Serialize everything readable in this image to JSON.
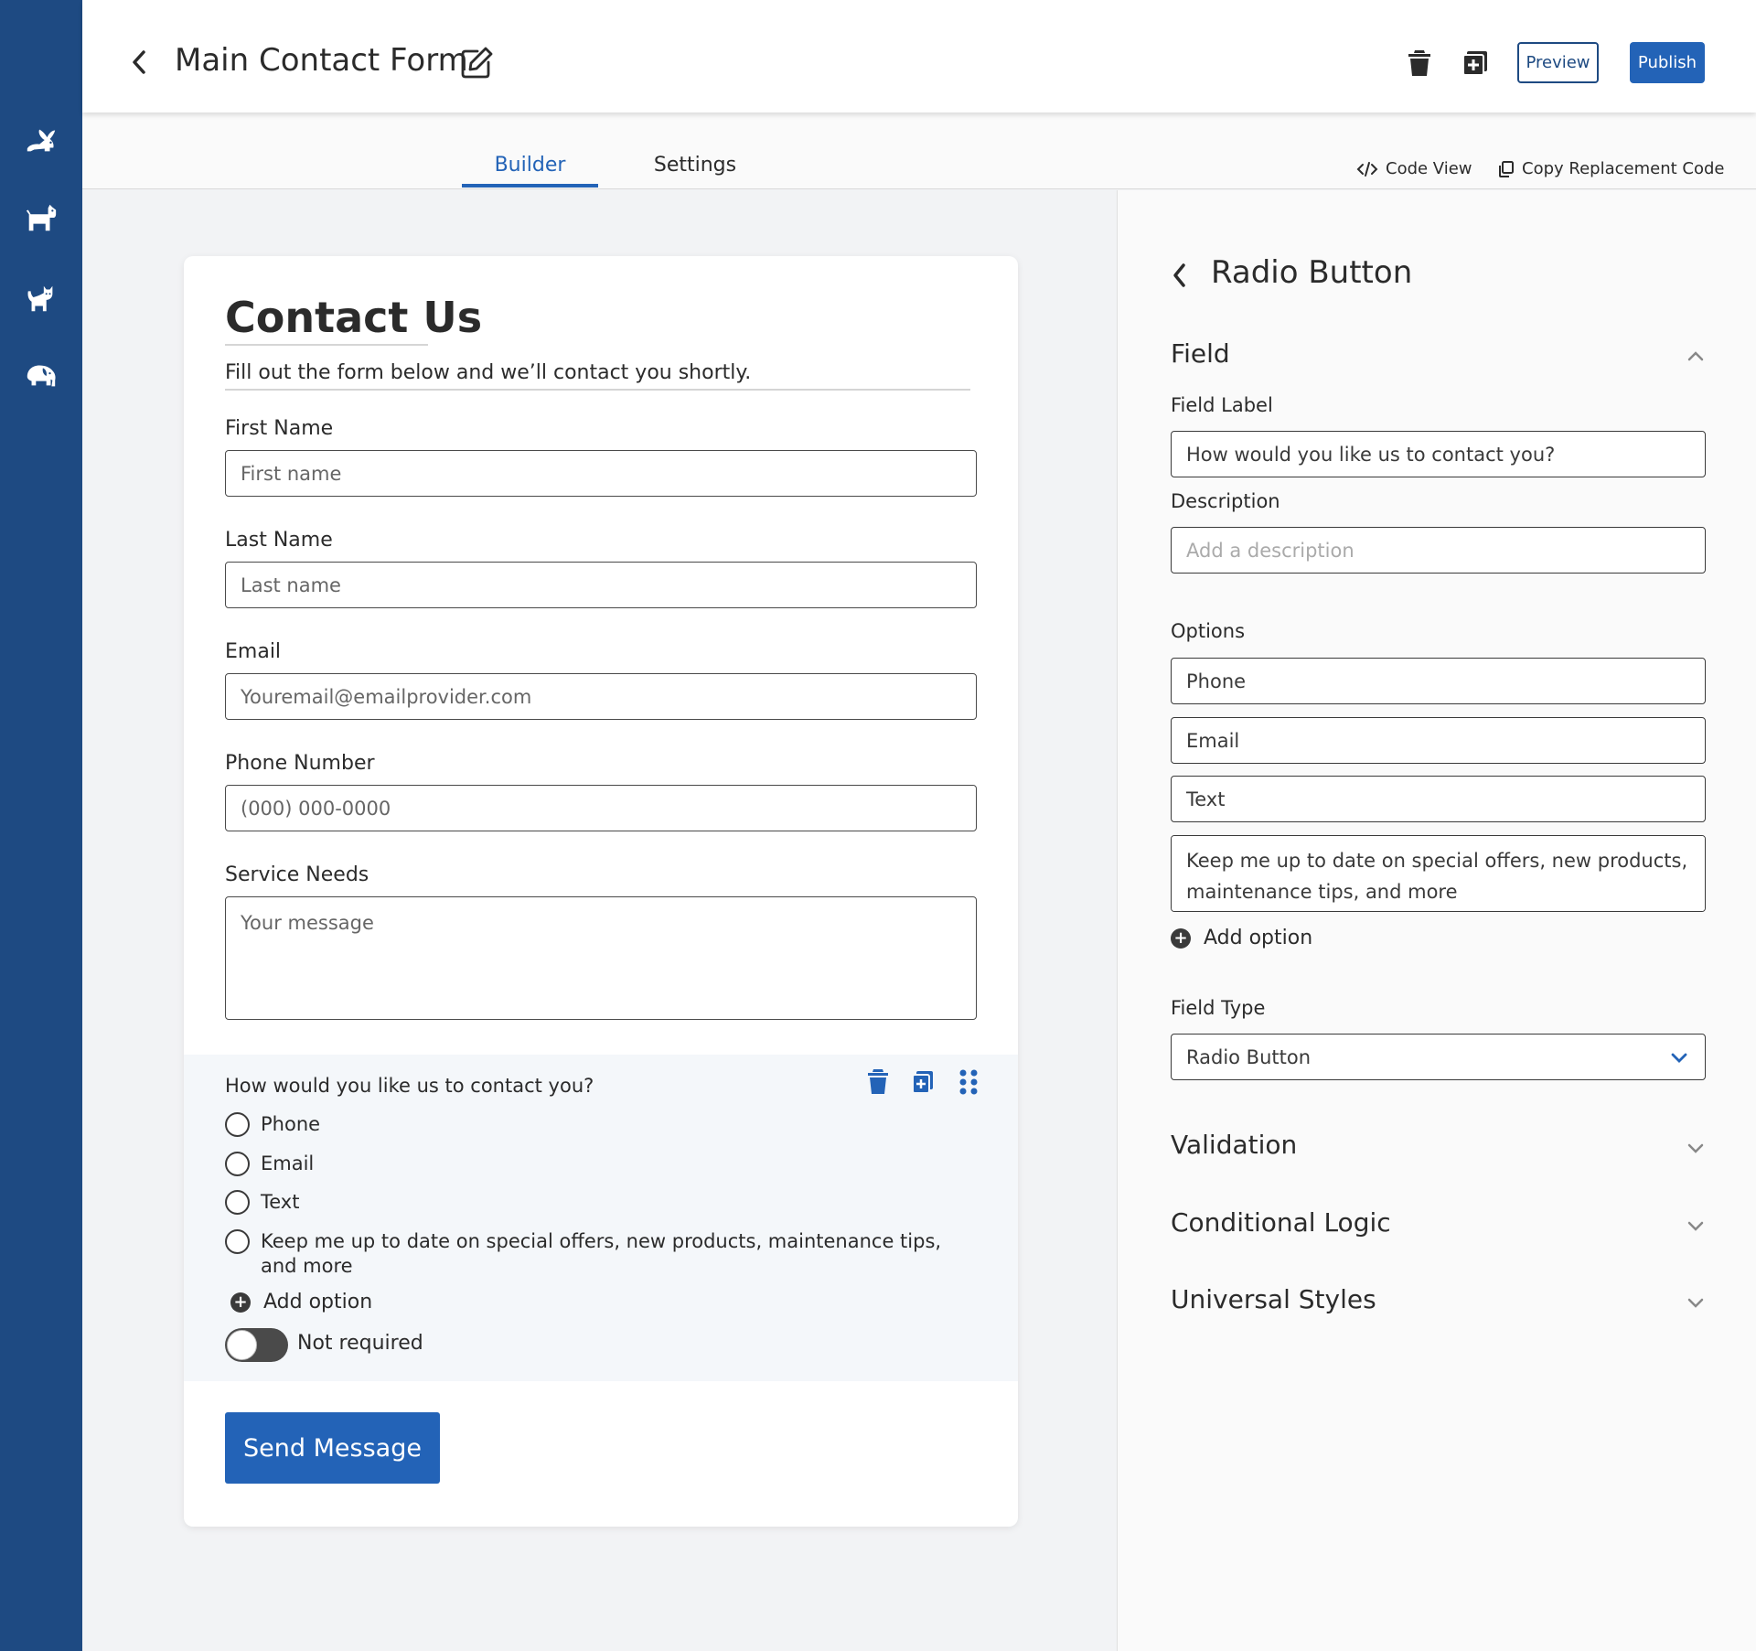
{
  "app": {
    "rail_icons": [
      "rabbit-icon",
      "dog-icon",
      "cat-icon",
      "elephant-icon"
    ]
  },
  "header": {
    "title": "Main Contact Form",
    "preview_label": "Preview",
    "publish_label": "Publish"
  },
  "tabs": {
    "builder": "Builder",
    "settings": "Settings",
    "active": "Builder",
    "code_view": "Code View",
    "copy_code": "Copy Replacement Code"
  },
  "form": {
    "title": "Contact Us",
    "subtitle": "Fill out the form below and we’ll contact you shortly.",
    "fields": [
      {
        "label": "First Name",
        "placeholder": "First name"
      },
      {
        "label": "Last Name",
        "placeholder": "Last name"
      },
      {
        "label": "Email",
        "placeholder": "Youremail@emailprovider.com"
      },
      {
        "label": "Phone Number",
        "placeholder": "(000) 000-0000"
      },
      {
        "label": "Service Needs",
        "placeholder": "Your message"
      }
    ],
    "radio_question": "How would you like us to contact you?",
    "radio_options": [
      "Phone",
      "Email",
      "Text",
      "Keep me up to date on special offers, new products, maintenance tips, and more"
    ],
    "add_option": "Add option",
    "required_toggle": {
      "label": "Not required",
      "on": false
    },
    "submit_label": "Send Message"
  },
  "panel": {
    "title": "Radio Button",
    "field_section": "Field",
    "field_label_label": "Field Label",
    "field_label_value": "How would you like us to contact you?",
    "description_label": "Description",
    "description_placeholder": "Add a description",
    "options_label": "Options",
    "options": [
      "Phone",
      "Email",
      "Text",
      "Keep me up to date on special offers, new products, maintenance tips, and more"
    ],
    "add_option": "Add option",
    "field_type_label": "Field Type",
    "field_type_value": "Radio Button",
    "sections": [
      "Validation",
      "Conditional Logic",
      "Universal Styles"
    ]
  },
  "colors": {
    "rail": "#1e4a82",
    "accent": "#2363b7"
  }
}
